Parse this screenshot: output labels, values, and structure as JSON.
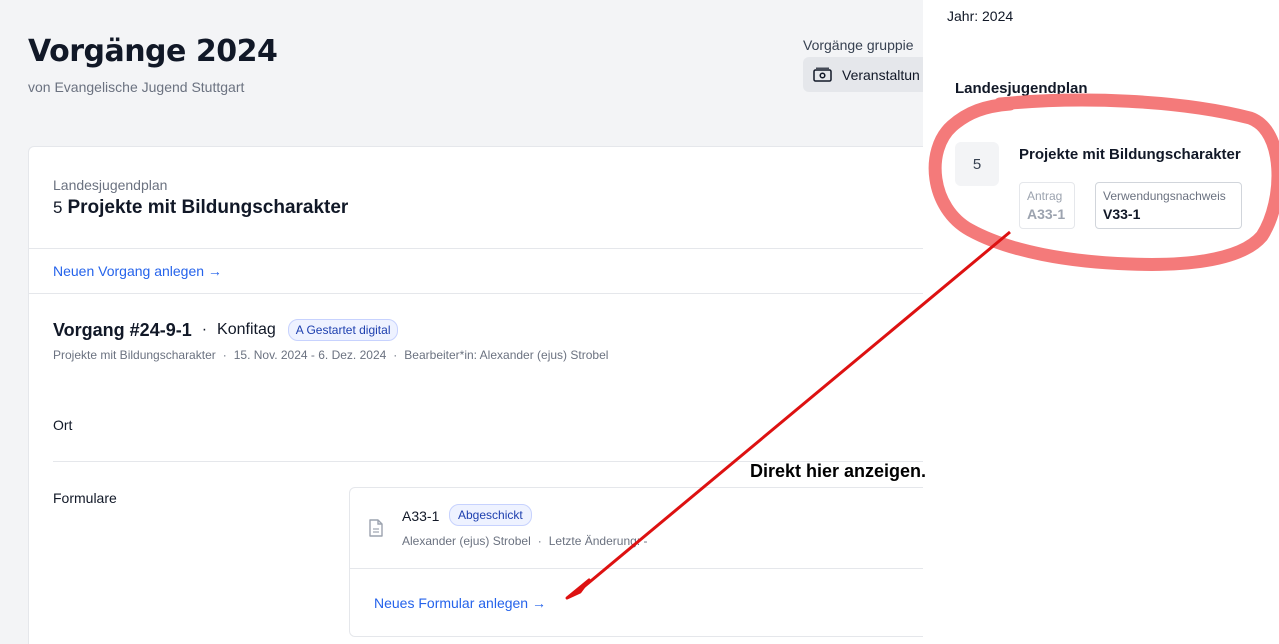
{
  "header": {
    "title": "Vorgänge 2024",
    "subtitle": "von Evangelische Jugend Stuttgart"
  },
  "grouping": {
    "label": "Vorgänge gruppie",
    "value": "Veranstaltun",
    "icon": "money-icon"
  },
  "card": {
    "category": "Landesjugendplan",
    "number": "5",
    "title": "Projekte mit Bildungscharakter",
    "new_vorgang_link": "Neuen Vorgang anlegen →",
    "vorgang": {
      "title": "Vorgang #24-9-1",
      "dot": "·",
      "type": "Konfitag",
      "status_badge": "A Gestartet digital",
      "meta_category": "Projekte mit Bildungscharakter",
      "meta_sep": "·",
      "meta_date": "15. Nov. 2024 - 6. Dez. 2024",
      "meta_editor": "Bearbeiter*in: Alexander (ejus) Strobel"
    },
    "ort_label": "Ort",
    "formulare_label": "Formulare",
    "form": {
      "name": "A33-1",
      "badge": "Abgeschickt",
      "author": "Alexander (ejus) Strobel",
      "sep": "·",
      "last_change": "Letzte Änderung: -",
      "new_form_link": "Neues Formular anlegen →"
    }
  },
  "side_panel": {
    "year": "Jahr: 2024",
    "section_title": "Landesjugendplan",
    "number": "5",
    "title": "Projekte mit Bildungscharakter",
    "antrag_label": "Antrag",
    "antrag_value": "A33-1",
    "nachweis_label": "Verwendungsnachweis",
    "nachweis_value": "V33-1"
  },
  "annotation": {
    "text": "Direkt hier anzeigen.",
    "circle_color": "#f47a7a",
    "arrow_color": "#dd1111"
  }
}
